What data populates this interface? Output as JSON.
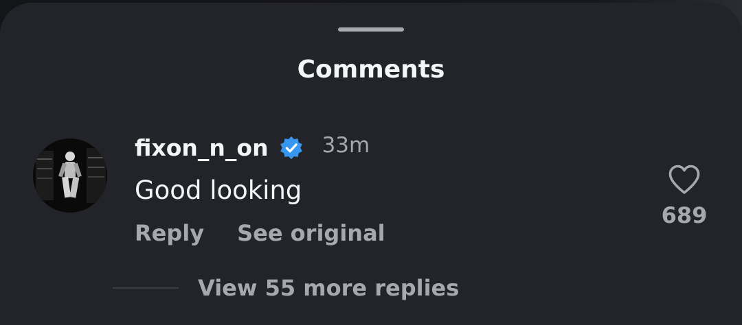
{
  "sheet": {
    "title": "Comments"
  },
  "comment": {
    "username": "fixon_n_on",
    "verified": true,
    "timestamp": "33m",
    "text": "Good looking",
    "actions": {
      "reply_label": "Reply",
      "see_original_label": "See original"
    },
    "like_count": "689",
    "view_replies_label": "View 55 more replies"
  },
  "colors": {
    "sheet_background": "#232429",
    "primary_text": "#f4f5f7",
    "secondary_text": "#a6a8ad",
    "verified_badge": "#3797f0"
  },
  "icons": {
    "verified": "verified-badge-icon",
    "like": "heart-outline-icon"
  }
}
